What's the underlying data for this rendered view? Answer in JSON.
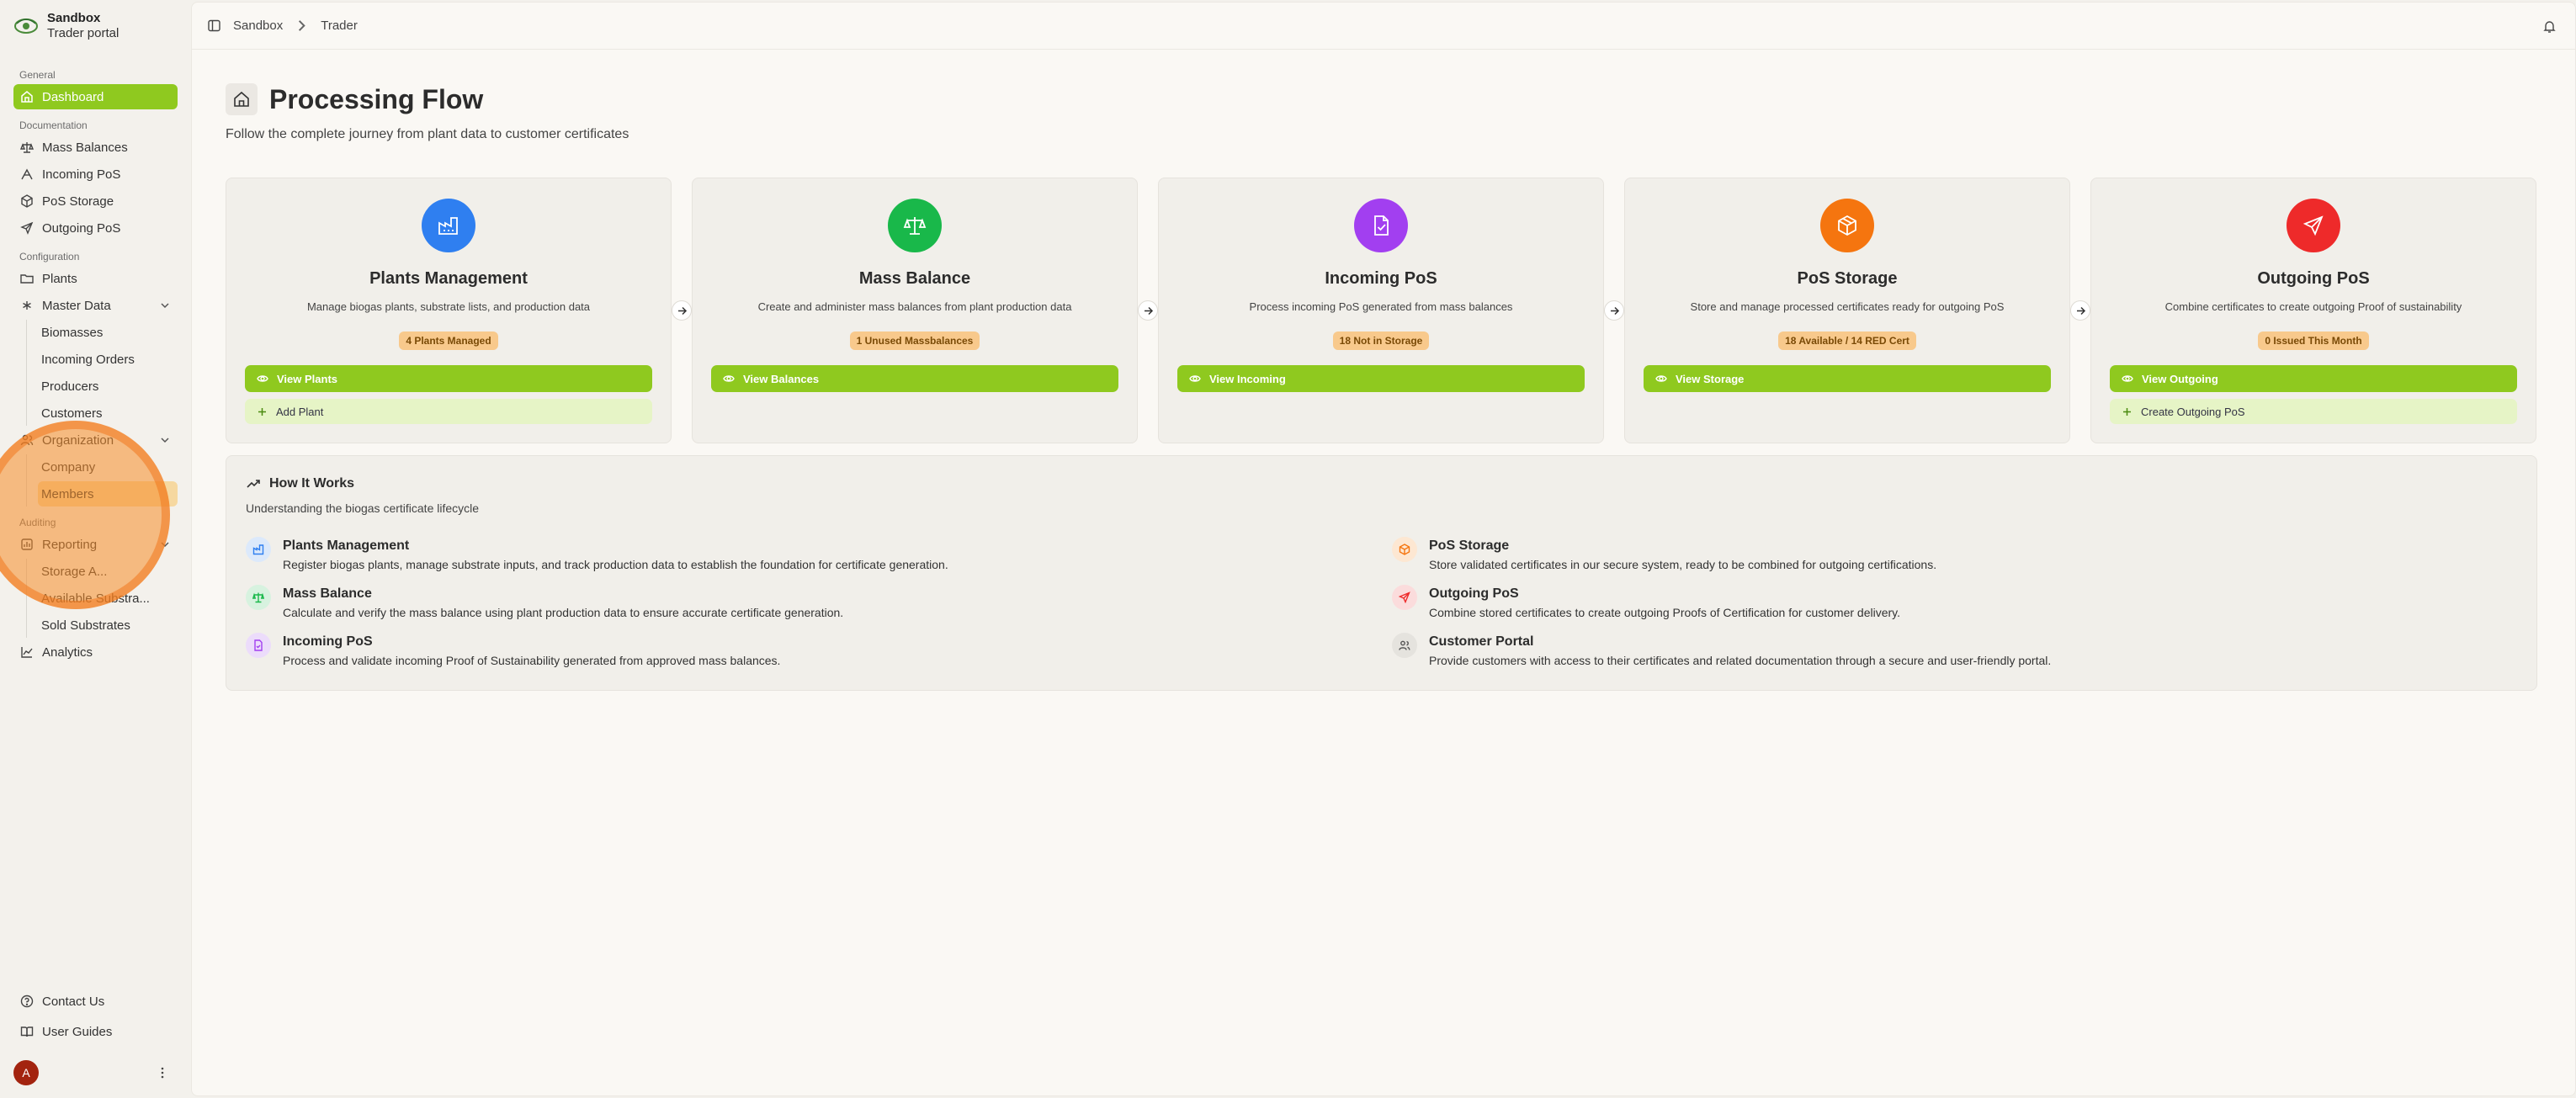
{
  "brand": {
    "name": "Sandbox",
    "subtitle": "Trader portal"
  },
  "sidebar": {
    "groups": {
      "general": "General",
      "documentation": "Documentation",
      "configuration": "Configuration",
      "auditing": "Auditing"
    },
    "items": {
      "dashboard": "Dashboard",
      "mass_balances": "Mass Balances",
      "incoming_pos": "Incoming PoS",
      "pos_storage": "PoS Storage",
      "outgoing_pos": "Outgoing PoS",
      "plants": "Plants",
      "master_data": "Master Data",
      "biomasses": "Biomasses",
      "incoming_orders": "Incoming Orders",
      "producers": "Producers",
      "customers": "Customers",
      "organization": "Organization",
      "company": "Company",
      "members": "Members",
      "reporting": "Reporting",
      "storage": "Storage A...",
      "available_substrates": "Available Substra...",
      "sold_substrates": "Sold Substrates",
      "analytics": "Analytics"
    },
    "bottom": {
      "contact": "Contact Us",
      "guides": "User Guides",
      "avatar_initial": "A"
    }
  },
  "breadcrumb": {
    "root": "Sandbox",
    "current": "Trader"
  },
  "page": {
    "title": "Processing Flow",
    "subtitle": "Follow the complete journey from plant data to customer certificates"
  },
  "cards": [
    {
      "title": "Plants Management",
      "desc": "Manage biogas plants, substrate lists, and production data",
      "badge": "4 Plants Managed",
      "primary": "View Plants",
      "secondary": "Add Plant",
      "color": "#2f7ff0"
    },
    {
      "title": "Mass Balance",
      "desc": "Create and administer mass balances from plant production data",
      "badge": "1 Unused Massbalances",
      "primary": "View Balances",
      "color": "#19b84a"
    },
    {
      "title": "Incoming PoS",
      "desc": "Process incoming PoS generated from mass balances",
      "badge": "18 Not in Storage",
      "primary": "View Incoming",
      "color": "#a23ff0"
    },
    {
      "title": "PoS Storage",
      "desc": "Store and manage processed certificates ready for outgoing PoS",
      "badge": "18 Available / 14 RED Cert",
      "primary": "View Storage",
      "color": "#f5750f"
    },
    {
      "title": "Outgoing PoS",
      "desc": "Combine certificates to create outgoing Proof of sustainability",
      "badge": "0 Issued This Month",
      "primary": "View Outgoing",
      "secondary": "Create Outgoing PoS",
      "color": "#ee2a2a"
    }
  ],
  "how": {
    "title": "How It Works",
    "subtitle": "Understanding the biogas certificate lifecycle",
    "steps": [
      {
        "title": "Plants Management",
        "desc": "Register biogas plants, manage substrate inputs, and track production data to establish the foundation for certificate generation."
      },
      {
        "title": "PoS Storage",
        "desc": "Store validated certificates in our secure system, ready to be combined for outgoing certifications."
      },
      {
        "title": "Mass Balance",
        "desc": "Calculate and verify the mass balance using plant production data to ensure accurate certificate generation."
      },
      {
        "title": "Outgoing PoS",
        "desc": "Combine stored certificates to create outgoing Proofs of Certification for customer delivery."
      },
      {
        "title": "Incoming PoS",
        "desc": "Process and validate incoming Proof of Sustainability generated from approved mass balances."
      },
      {
        "title": "Customer Portal",
        "desc": "Provide customers with access to their certificates and related documentation through a secure and user-friendly portal."
      }
    ]
  },
  "colors": {
    "accent": "#8fc91f",
    "accent_light": "#e6f4c6",
    "badge_bg": "#f8c98c",
    "badge_text": "#7a4a06"
  }
}
